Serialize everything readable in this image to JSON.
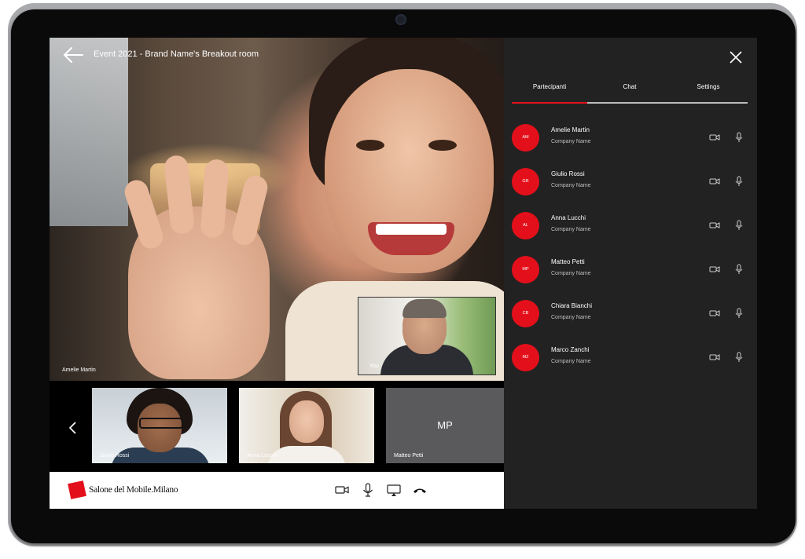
{
  "call": {
    "room_title": "Event 2021 - Brand Name's Breakout room",
    "main_speaker": "Amelie Martin",
    "self_label": "You"
  },
  "thumbnails": [
    {
      "name": "Giulio Rossi"
    },
    {
      "name": "Anna Lucchi"
    },
    {
      "name": "Matteo Petti",
      "initials": "MP"
    }
  ],
  "brand": {
    "logo_text": "Salone del Mobile.Milano",
    "accent": "#e3101b"
  },
  "controls": [
    "camera-icon",
    "microphone-icon",
    "screen-share-icon",
    "hang-up-icon"
  ],
  "panel": {
    "tabs": [
      {
        "label": "Partecipanti",
        "active": true
      },
      {
        "label": "Chat",
        "active": false
      },
      {
        "label": "Settings",
        "active": false
      }
    ],
    "participants": [
      {
        "initials": "AM",
        "name": "Amelie Martin",
        "company": "Company Name"
      },
      {
        "initials": "GR",
        "name": "Giulio Rossi",
        "company": "Company Name"
      },
      {
        "initials": "AL",
        "name": "Anna Lucchi",
        "company": "Company Name"
      },
      {
        "initials": "MP",
        "name": "Matteo Petti",
        "company": "Company Name"
      },
      {
        "initials": "CB",
        "name": "Chiara Bianchi",
        "company": "Company Name"
      },
      {
        "initials": "MZ",
        "name": "Marco Zanchi",
        "company": "Company Name"
      }
    ]
  }
}
